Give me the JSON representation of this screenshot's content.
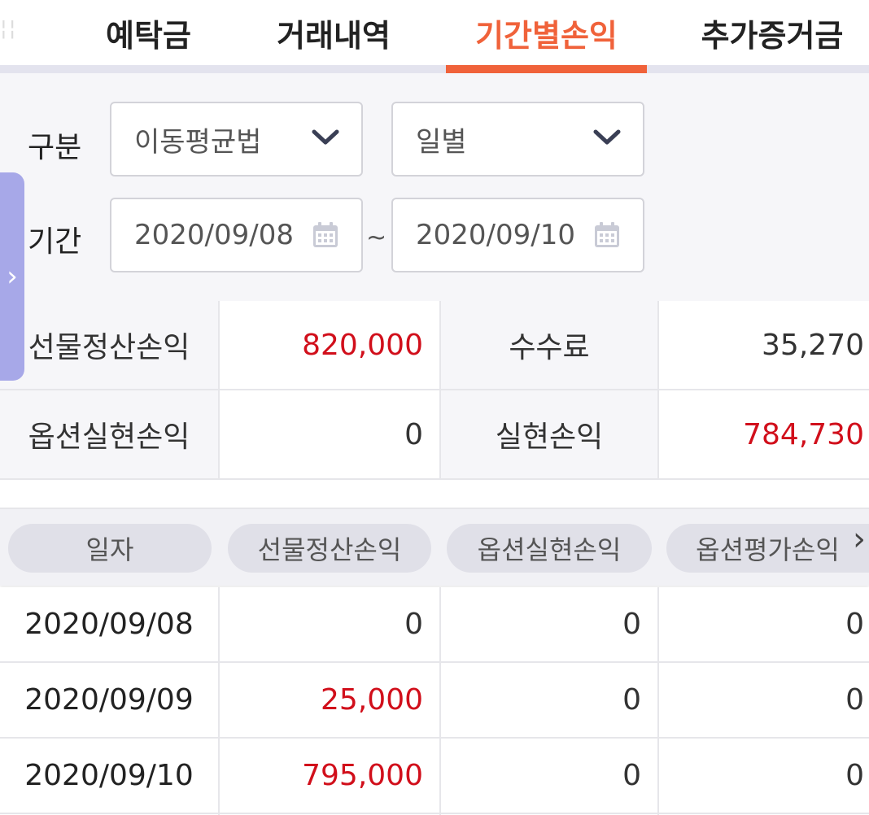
{
  "tabs": [
    {
      "label": "예탁금",
      "active": false
    },
    {
      "label": "거래내역",
      "active": false
    },
    {
      "label": "기간별손익",
      "active": true
    },
    {
      "label": "추가증거금",
      "active": false
    }
  ],
  "filter": {
    "category_label": "구분",
    "method_select": "이동평균법",
    "period_select": "일별",
    "period_label": "기간",
    "date_from": "2020/09/08",
    "date_separator": "~",
    "date_to": "2020/09/10"
  },
  "summary": {
    "futures_settlement_label": "선물정산손익",
    "futures_settlement_value": "820,000",
    "fee_label": "수수료",
    "fee_value": "35,270",
    "option_realized_label": "옵션실현손익",
    "option_realized_value": "0",
    "realized_label": "실현손익",
    "realized_value": "784,730"
  },
  "table": {
    "headers": [
      "일자",
      "선물정산손익",
      "옵션실현손익",
      "옵션평가손익"
    ],
    "rows": [
      {
        "date": "2020/09/08",
        "futures": "0",
        "option_realized": "0",
        "option_eval": "0"
      },
      {
        "date": "2020/09/09",
        "futures": "25,000",
        "option_realized": "0",
        "option_eval": "0"
      },
      {
        "date": "2020/09/10",
        "futures": "795,000",
        "option_realized": "0",
        "option_eval": "0"
      }
    ]
  },
  "icons": {
    "dropdown": "chevron-down-icon",
    "calendar": "calendar-icon",
    "side_handle": "chevron-right-icon",
    "scroll_more": "chevron-right-icon"
  },
  "colors": {
    "accent": "#f0623a",
    "positive": "#d10f1b",
    "handle": "#a7a8e8"
  }
}
